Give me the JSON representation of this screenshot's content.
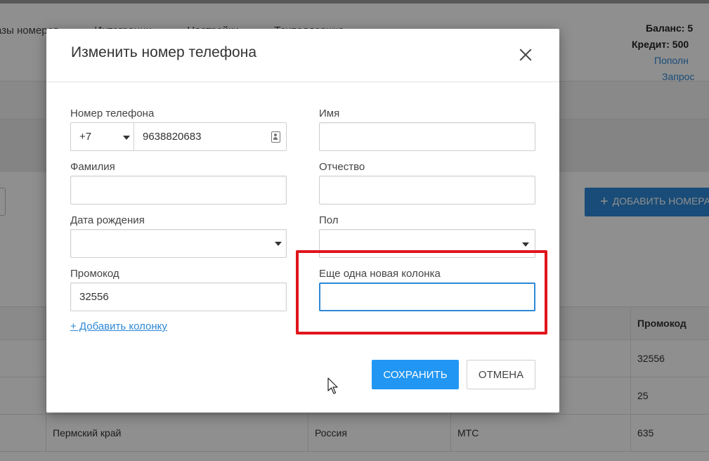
{
  "topnav": {
    "items": [
      {
        "label": "азы номеров",
        "chevron": true
      },
      {
        "label": "Интеграции",
        "chevron": true
      },
      {
        "label": "Настройки",
        "chevron": true
      },
      {
        "label": "Техподдержка",
        "chevron": false
      }
    ]
  },
  "account": {
    "balance": "Баланс: 5",
    "credit": "Кредит: 500",
    "topup_link": "Пополн",
    "request_link": "Запрос"
  },
  "page": {
    "add_number_button": "ДОБАВИТЬ НОМЕРА"
  },
  "table": {
    "header": [
      "",
      "",
      "",
      "",
      "Промокод"
    ],
    "rows": [
      [
        "",
        "",
        "",
        "",
        "32556"
      ],
      [
        "",
        "",
        "",
        "",
        "25"
      ],
      [
        "",
        "Пермский край",
        "Россия",
        "МТС",
        "635"
      ]
    ]
  },
  "modal": {
    "title": "Изменить номер телефона",
    "fields": {
      "phone": {
        "label": "Номер телефона",
        "country_code": "+7",
        "value": "9638820683"
      },
      "first_name": {
        "label": "Имя",
        "value": ""
      },
      "last_name": {
        "label": "Фамилия",
        "value": ""
      },
      "middle_name": {
        "label": "Отчество",
        "value": ""
      },
      "birth_date": {
        "label": "Дата рождения",
        "value": ""
      },
      "gender": {
        "label": "Пол",
        "value": ""
      },
      "promo": {
        "label": "Промокод",
        "value": "32556"
      },
      "new_column": {
        "label": "Еще одна новая колонка",
        "value": ""
      }
    },
    "add_column_link": "+ Добавить колонку",
    "save_button": "СОХРАНИТЬ",
    "cancel_button": "ОТМЕНА"
  },
  "colors": {
    "primary": "#2196f3",
    "link": "#2e88d6",
    "highlight": "#e0151c"
  }
}
